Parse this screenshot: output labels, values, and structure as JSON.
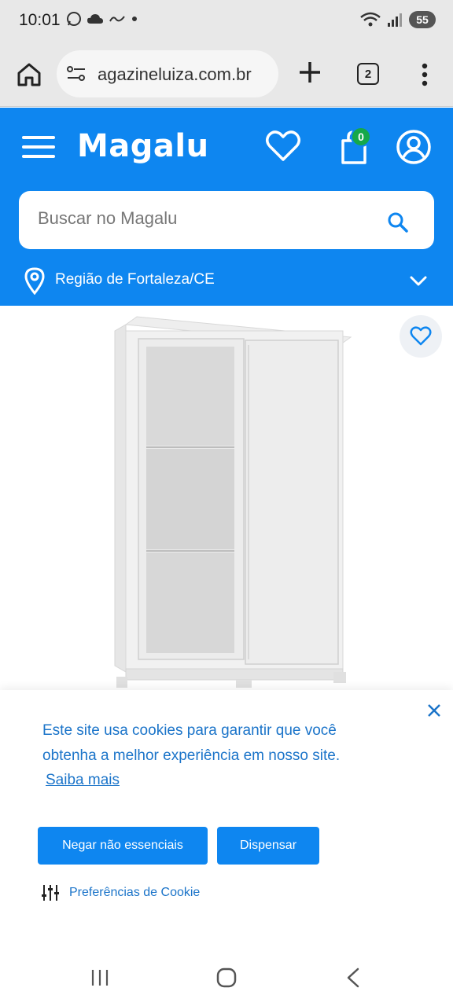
{
  "status_bar": {
    "time": "10:01",
    "left_icons": [
      "whatsapp-icon",
      "cloud-icon",
      "notification-icon",
      "dot-icon"
    ],
    "right_icons": [
      "wifi-icon",
      "signal-icon"
    ],
    "battery": "55"
  },
  "browser": {
    "url": "agazineluiza.com.br",
    "tab_count": "2",
    "icons": [
      "home-icon",
      "site-info-icon",
      "plus-icon",
      "tabs-icon",
      "menu-dots-icon"
    ]
  },
  "header": {
    "logo": "Magalu",
    "cart_count": "0",
    "search_placeholder": "Buscar no Magalu",
    "region": "Região de Fortaleza/CE",
    "colors": {
      "brand_blue": "#0e86f0",
      "badge_green": "#15a84a"
    },
    "icons": [
      "hamburger-icon",
      "heart-icon",
      "bag-icon",
      "account-icon",
      "search-icon",
      "location-pin-icon",
      "chevron-down-icon"
    ]
  },
  "product": {
    "image": "wardrobe-product-image",
    "favorite_icon": "heart-icon"
  },
  "cookie_banner": {
    "message": "Este site usa cookies para garantir que você obtenha a melhor experiência em nosso site.",
    "learn_more": "Saiba mais",
    "deny_button": "Negar não essenciais",
    "dismiss_button": "Dispensar",
    "preferences": "Preferências de Cookie",
    "text_color": "#1b74c9"
  },
  "nav_bar": {
    "icons": [
      "recents-icon",
      "home-icon",
      "back-icon"
    ]
  }
}
